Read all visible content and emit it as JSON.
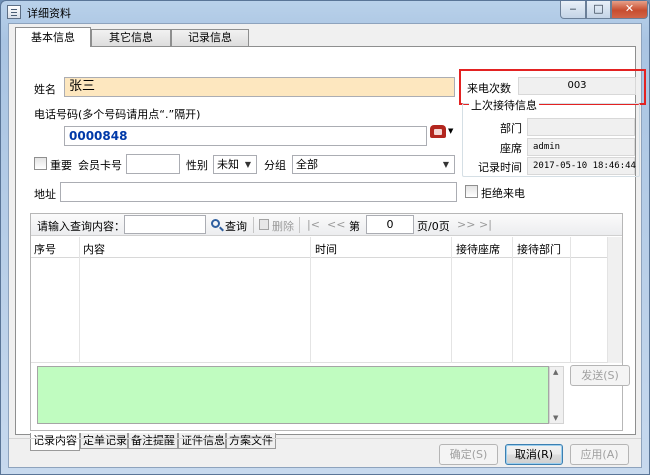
{
  "window": {
    "title": "详细资料",
    "minimize_glyph": "‒",
    "maximize_glyph": "□",
    "close_glyph": "✕"
  },
  "tabs": [
    {
      "label": "基本信息",
      "active": true
    },
    {
      "label": "其它信息",
      "active": false
    },
    {
      "label": "记录信息",
      "active": false
    }
  ],
  "form": {
    "name_label": "姓名",
    "name_value": "张三",
    "phone_label": "电话号码(多个号码请用点“.”隔开)",
    "phone_value": "0000848",
    "important_label": "重要",
    "member_card_label": "会员卡号",
    "member_card_value": "",
    "gender_label": "性别",
    "gender_value": "未知",
    "group_label": "分组",
    "group_value": "全部",
    "address_label": "地址",
    "address_value": "",
    "reject_label": "拒绝来电"
  },
  "call_count": {
    "label": "来电次数",
    "value": "003"
  },
  "last_reception": {
    "title": "上次接待信息",
    "department_label": "部门",
    "department_value": "",
    "seat_label": "座席",
    "seat_value": "admin",
    "time_label": "记录时间",
    "time_value": "2017-05-10 18:46:44"
  },
  "toolbar": {
    "query_label": "请输入查询内容：",
    "query_value": "",
    "search_button": "查询",
    "delete_button": "删除",
    "first": "|<",
    "prev": "<<",
    "page_prefix": "第",
    "page_value": "0",
    "page_suffix": "页/0页",
    "next": ">>",
    "last": ">|"
  },
  "table": {
    "columns": [
      "序号",
      "内容",
      "时间",
      "接待座席",
      "接待部门"
    ]
  },
  "send_button": "发送(S)",
  "bottom_tabs": [
    "记录内容",
    "定单记录",
    "备注提醒",
    "证件信息",
    "方案文件"
  ],
  "dialog_buttons": {
    "ok": "确定(S)",
    "cancel": "取消(R)",
    "apply": "应用(A)"
  },
  "colors": {
    "highlight_border": "#e32222",
    "name_bg": "#fde7bf",
    "phone_text": "#0039a8",
    "message_bg": "#c0fcc0"
  },
  "icons": {
    "window": "window-icon",
    "phone": "phone-icon",
    "search": "search-icon",
    "delete": "delete-icon"
  }
}
